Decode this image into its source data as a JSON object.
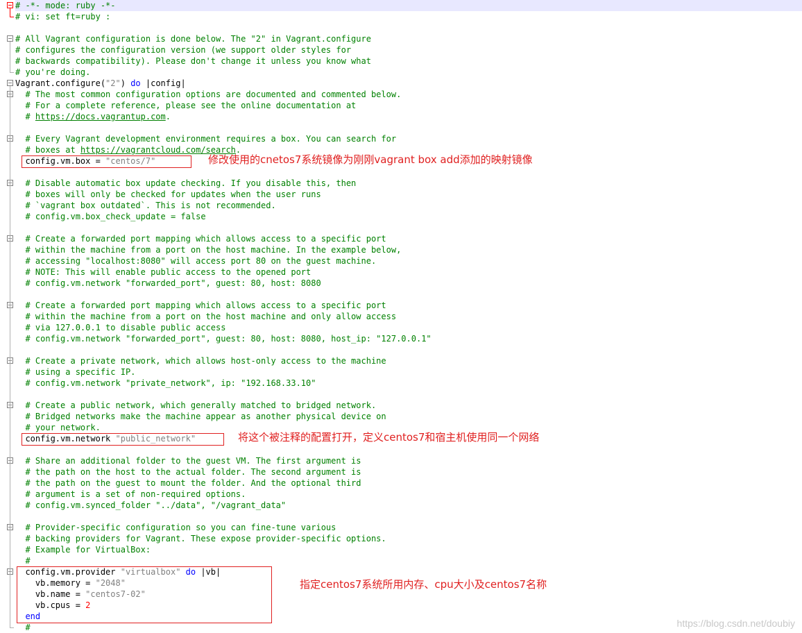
{
  "editor": {
    "language": "ruby",
    "lines": [
      "# -*- mode: ruby -*-",
      "# vi: set ft=ruby :",
      "",
      "# All Vagrant configuration is done below. The \"2\" in Vagrant.configure",
      "# configures the configuration version (we support older styles for",
      "# backwards compatibility). Please don't change it unless you know what",
      "# you're doing.",
      "Vagrant.configure(\"2\") do |config|",
      "  # The most common configuration options are documented and commented below.",
      "  # For a complete reference, please see the online documentation at",
      "  # https://docs.vagrantup.com.",
      "",
      "  # Every Vagrant development environment requires a box. You can search for",
      "  # boxes at https://vagrantcloud.com/search.",
      "  config.vm.box = \"centos/7\"",
      "",
      "  # Disable automatic box update checking. If you disable this, then",
      "  # boxes will only be checked for updates when the user runs",
      "  # `vagrant box outdated`. This is not recommended.",
      "  # config.vm.box_check_update = false",
      "",
      "  # Create a forwarded port mapping which allows access to a specific port",
      "  # within the machine from a port on the host machine. In the example below,",
      "  # accessing \"localhost:8080\" will access port 80 on the guest machine.",
      "  # NOTE: This will enable public access to the opened port",
      "  # config.vm.network \"forwarded_port\", guest: 80, host: 8080",
      "",
      "  # Create a forwarded port mapping which allows access to a specific port",
      "  # within the machine from a port on the host machine and only allow access",
      "  # via 127.0.0.1 to disable public access",
      "  # config.vm.network \"forwarded_port\", guest: 80, host: 8080, host_ip: \"127.0.0.1\"",
      "",
      "  # Create a private network, which allows host-only access to the machine",
      "  # using a specific IP.",
      "  # config.vm.network \"private_network\", ip: \"192.168.33.10\"",
      "",
      "  # Create a public network, which generally matched to bridged network.",
      "  # Bridged networks make the machine appear as another physical device on",
      "  # your network.",
      "  config.vm.network \"public_network\"",
      "",
      "  # Share an additional folder to the guest VM. The first argument is",
      "  # the path on the host to the actual folder. The second argument is",
      "  # the path on the guest to mount the folder. And the optional third",
      "  # argument is a set of non-required options.",
      "  # config.vm.synced_folder \"../data\", \"/vagrant_data\"",
      "",
      "  # Provider-specific configuration so you can fine-tune various",
      "  # backing providers for Vagrant. These expose provider-specific options.",
      "  # Example for VirtualBox:",
      "  #",
      "  config.vm.provider \"virtualbox\" do |vb|",
      "    vb.memory = \"2048\"",
      "    vb.name = \"centos7-02\"",
      "    vb.cpus = 2",
      "  end",
      "  #"
    ]
  },
  "annotations": {
    "box_note": "修改使用的cnetos7系统镜像为刚刚vagrant box add添加的映射镜像",
    "network_note": "将这个被注释的配置打开，定义centos7和宿主机使用同一个网络",
    "provider_note": "指定centos7系统所用内存、cpu大小及centos7名称"
  },
  "watermark": "https://blog.csdn.net/doubiy",
  "colors": {
    "comment": "#008000",
    "keyword": "#0000ff",
    "string": "#808080",
    "number": "#ff0000",
    "annotation": "#e02020",
    "active_line": "#e8e8ff"
  }
}
